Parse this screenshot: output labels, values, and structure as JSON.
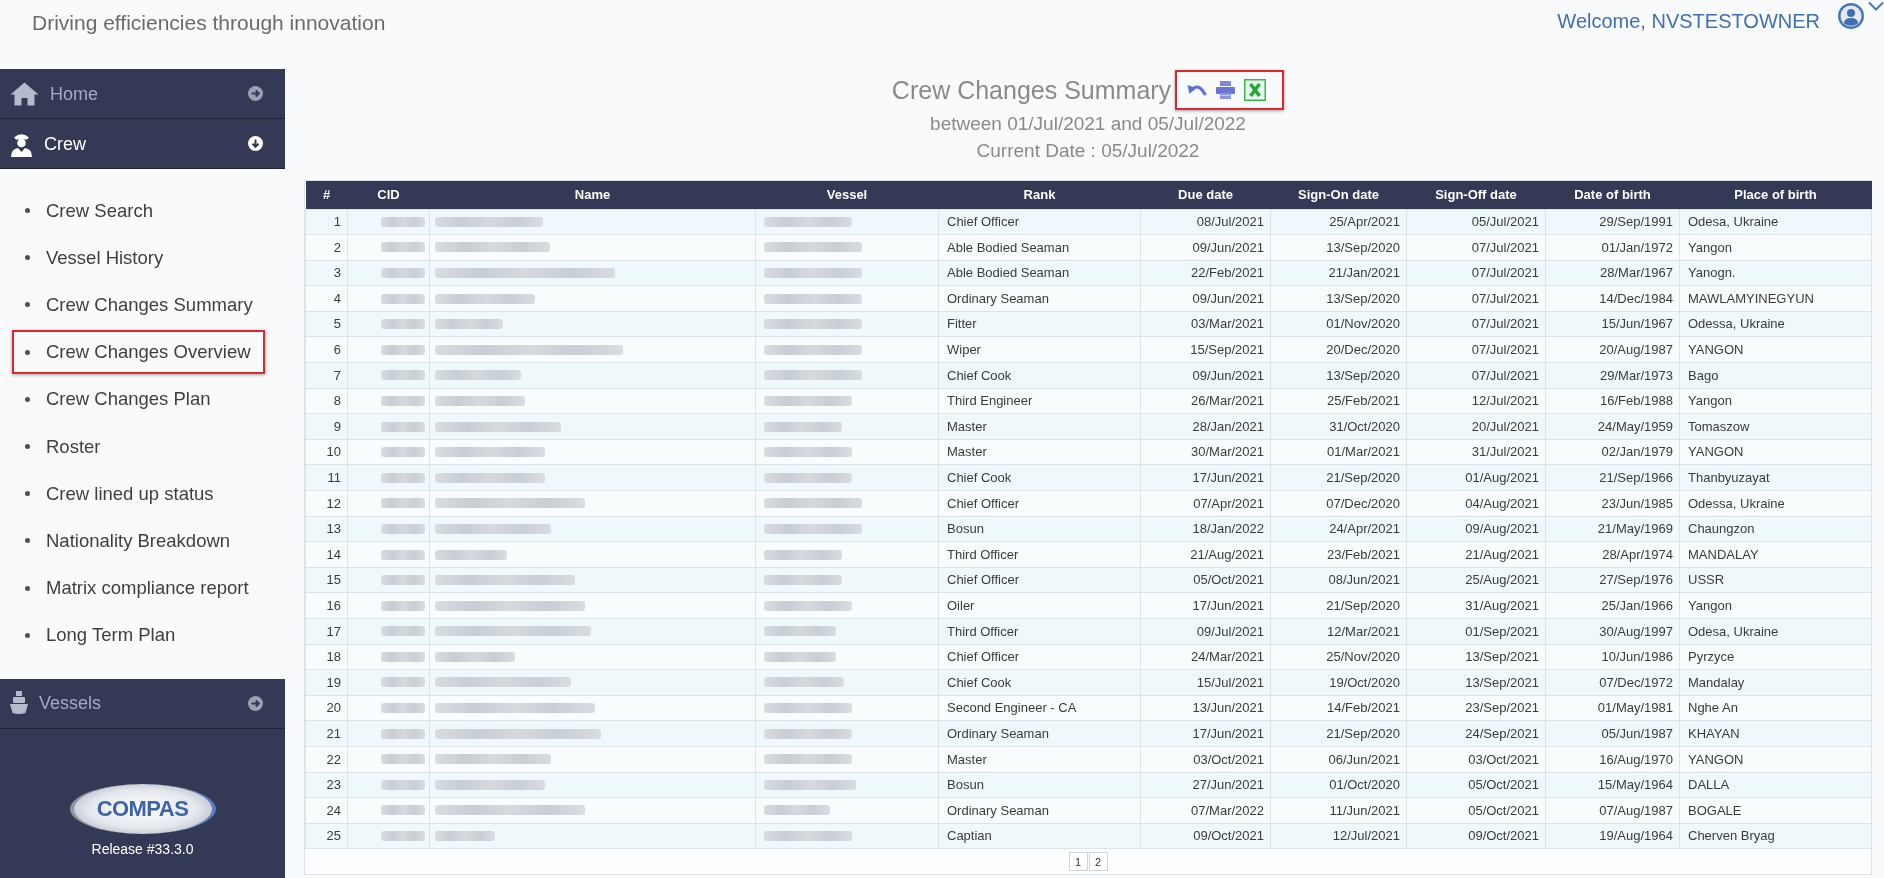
{
  "header": {
    "tagline": "Driving efficiencies through innovation",
    "welcome": "Welcome, NVSTESTOWNER"
  },
  "sidebar": {
    "sections": [
      {
        "label": "Home",
        "expanded": false
      },
      {
        "label": "Crew",
        "expanded": true,
        "items": [
          {
            "label": "Crew Search",
            "highlighted": false
          },
          {
            "label": "Vessel History",
            "highlighted": false
          },
          {
            "label": "Crew Changes Summary",
            "highlighted": false
          },
          {
            "label": "Crew Changes Overview",
            "highlighted": true
          },
          {
            "label": "Crew Changes Plan",
            "highlighted": false
          },
          {
            "label": "Roster",
            "highlighted": false
          },
          {
            "label": "Crew lined up status",
            "highlighted": false
          },
          {
            "label": "Nationality Breakdown",
            "highlighted": false
          },
          {
            "label": "Matrix compliance report",
            "highlighted": false
          },
          {
            "label": "Long Term Plan",
            "highlighted": false
          }
        ]
      },
      {
        "label": "Vessels",
        "expanded": false
      }
    ],
    "logo": "COMPAS",
    "release": "Release #33.3.0"
  },
  "report": {
    "title": "Crew Changes Summary",
    "toolbar_highlighted": true,
    "subtitle": "between 01/Jul/2021 and 05/Jul/2022",
    "current_date": "Current Date : 05/Jul/2022"
  },
  "table": {
    "columns": [
      {
        "label": "#",
        "kind": "number"
      },
      {
        "label": "CID",
        "kind": "blurred"
      },
      {
        "label": "Name",
        "kind": "blurred"
      },
      {
        "label": "Vessel",
        "kind": "blurred"
      },
      {
        "label": "Rank",
        "kind": "text"
      },
      {
        "label": "Due date",
        "kind": "date"
      },
      {
        "label": "Sign-On date",
        "kind": "date"
      },
      {
        "label": "Sign-Off date",
        "kind": "date"
      },
      {
        "label": "Date of birth",
        "kind": "date"
      },
      {
        "label": "Place of birth",
        "kind": "text"
      }
    ],
    "rows": [
      {
        "cells": [
          "1",
          "",
          "",
          "",
          "Chief Officer",
          "08/Jul/2021",
          "25/Apr/2021",
          "05/Jul/2021",
          "29/Sep/1991",
          "Odesa, Ukraine"
        ]
      },
      {
        "cells": [
          "2",
          "",
          "",
          "",
          "Able Bodied Seaman",
          "09/Jun/2021",
          "13/Sep/2020",
          "07/Jul/2021",
          "01/Jan/1972",
          "Yangon"
        ]
      },
      {
        "cells": [
          "3",
          "",
          "",
          "",
          "Able Bodied Seaman",
          "22/Feb/2021",
          "21/Jan/2021",
          "07/Jul/2021",
          "28/Mar/1967",
          "Yanogn."
        ]
      },
      {
        "cells": [
          "4",
          "",
          "",
          "",
          "Ordinary Seaman",
          "09/Jun/2021",
          "13/Sep/2020",
          "07/Jul/2021",
          "14/Dec/1984",
          "MAWLAMYINEGYUN"
        ]
      },
      {
        "cells": [
          "5",
          "",
          "",
          "",
          "Fitter",
          "03/Mar/2021",
          "01/Nov/2020",
          "07/Jul/2021",
          "15/Jun/1967",
          "Odessa, Ukraine"
        ]
      },
      {
        "cells": [
          "6",
          "",
          "",
          "",
          "Wiper",
          "15/Sep/2021",
          "20/Dec/2020",
          "07/Jul/2021",
          "20/Aug/1987",
          "YANGON"
        ]
      },
      {
        "cells": [
          "7",
          "",
          "",
          "",
          "Chief Cook",
          "09/Jun/2021",
          "13/Sep/2020",
          "07/Jul/2021",
          "29/Mar/1973",
          "Bago"
        ]
      },
      {
        "cells": [
          "8",
          "",
          "",
          "",
          "Third Engineer",
          "26/Mar/2021",
          "25/Feb/2021",
          "12/Jul/2021",
          "16/Feb/1988",
          "Yangon"
        ]
      },
      {
        "cells": [
          "9",
          "",
          "",
          "",
          "Master",
          "28/Jan/2021",
          "31/Oct/2020",
          "20/Jul/2021",
          "24/May/1959",
          "Tomaszow"
        ]
      },
      {
        "cells": [
          "10",
          "",
          "",
          "",
          "Master",
          "30/Mar/2021",
          "01/Mar/2021",
          "31/Jul/2021",
          "02/Jan/1979",
          "YANGON"
        ]
      },
      {
        "cells": [
          "11",
          "",
          "",
          "",
          "Chief Cook",
          "17/Jun/2021",
          "21/Sep/2020",
          "01/Aug/2021",
          "21/Sep/1966",
          "Thanbyuzayat"
        ]
      },
      {
        "cells": [
          "12",
          "",
          "",
          "",
          "Chief Officer",
          "07/Apr/2021",
          "07/Dec/2020",
          "04/Aug/2021",
          "23/Jun/1985",
          "Odessa, Ukraine"
        ]
      },
      {
        "cells": [
          "13",
          "",
          "",
          "",
          "Bosun",
          "18/Jan/2022",
          "24/Apr/2021",
          "09/Aug/2021",
          "21/May/1969",
          "Chaungzon"
        ]
      },
      {
        "cells": [
          "14",
          "",
          "",
          "",
          "Third Officer",
          "21/Aug/2021",
          "23/Feb/2021",
          "21/Aug/2021",
          "28/Apr/1974",
          "MANDALAY"
        ]
      },
      {
        "cells": [
          "15",
          "",
          "",
          "",
          "Chief Officer",
          "05/Oct/2021",
          "08/Jun/2021",
          "25/Aug/2021",
          "27/Sep/1976",
          "USSR"
        ]
      },
      {
        "cells": [
          "16",
          "",
          "",
          "",
          "Oiler",
          "17/Jun/2021",
          "21/Sep/2020",
          "31/Aug/2021",
          "25/Jan/1966",
          "Yangon"
        ]
      },
      {
        "cells": [
          "17",
          "",
          "",
          "",
          "Third Officer",
          "09/Jul/2021",
          "12/Mar/2021",
          "01/Sep/2021",
          "30/Aug/1997",
          "Odesa, Ukraine"
        ]
      },
      {
        "cells": [
          "18",
          "",
          "",
          "",
          "Chief Officer",
          "24/Mar/2021",
          "25/Nov/2020",
          "13/Sep/2021",
          "10/Jun/1986",
          "Pyrzyce"
        ]
      },
      {
        "cells": [
          "19",
          "",
          "",
          "",
          "Chief Cook",
          "15/Jul/2021",
          "19/Oct/2020",
          "13/Sep/2021",
          "07/Dec/1972",
          "Mandalay"
        ]
      },
      {
        "cells": [
          "20",
          "",
          "",
          "",
          "Second Engineer - CA",
          "13/Jun/2021",
          "14/Feb/2021",
          "23/Sep/2021",
          "01/May/1981",
          "Nghe An"
        ]
      },
      {
        "cells": [
          "21",
          "",
          "",
          "",
          "Ordinary Seaman",
          "17/Jun/2021",
          "21/Sep/2020",
          "24/Sep/2021",
          "05/Jun/1987",
          "KHAYAN"
        ]
      },
      {
        "cells": [
          "22",
          "",
          "",
          "",
          "Master",
          "03/Oct/2021",
          "06/Jun/2021",
          "03/Oct/2021",
          "16/Aug/1970",
          "YANGON"
        ]
      },
      {
        "cells": [
          "23",
          "",
          "",
          "",
          "Bosun",
          "27/Jun/2021",
          "01/Oct/2020",
          "05/Oct/2021",
          "15/May/1964",
          "DALLA"
        ]
      },
      {
        "cells": [
          "24",
          "",
          "",
          "",
          "Ordinary Seaman",
          "07/Mar/2022",
          "11/Jun/2021",
          "05/Oct/2021",
          "07/Aug/1987",
          "BOGALE"
        ]
      },
      {
        "cells": [
          "25",
          "",
          "",
          "",
          "Captian",
          "09/Oct/2021",
          "12/Jul/2021",
          "09/Oct/2021",
          "19/Aug/1964",
          "Cherven Bryag"
        ]
      }
    ]
  },
  "pagination": {
    "pages": [
      "1",
      "2"
    ]
  }
}
